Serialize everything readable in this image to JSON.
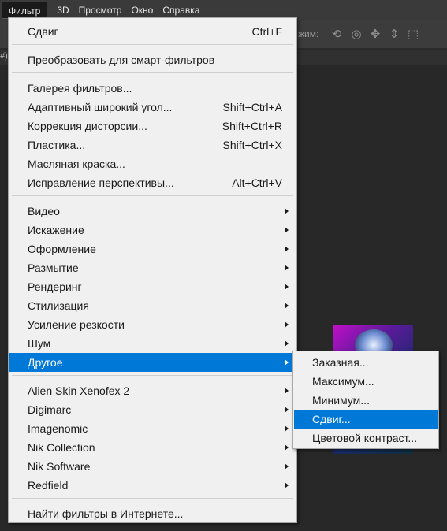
{
  "menubar": {
    "items": [
      {
        "label": "Фильтр"
      },
      {
        "label": "3D"
      },
      {
        "label": "Просмотр"
      },
      {
        "label": "Окно"
      },
      {
        "label": "Справка"
      }
    ]
  },
  "options_bar": {
    "mode_label_fragment": "жим:",
    "icons": [
      "rotate-3d-icon",
      "roll-3d-icon",
      "pan-3d-icon",
      "slide-3d-icon",
      "scale-3d-icon"
    ]
  },
  "tab_bar": {
    "fragment": "#)"
  },
  "filter_menu": {
    "items": [
      {
        "label": "Сдвиг",
        "shortcut": "Ctrl+F",
        "submenu": false
      },
      {
        "label": "Преобразовать для смарт-фильтров",
        "shortcut": "",
        "submenu": false
      },
      {
        "label": "Галерея фильтров...",
        "shortcut": "",
        "submenu": false
      },
      {
        "label": "Адаптивный широкий угол...",
        "shortcut": "Shift+Ctrl+A",
        "submenu": false
      },
      {
        "label": "Коррекция дисторсии...",
        "shortcut": "Shift+Ctrl+R",
        "submenu": false
      },
      {
        "label": "Пластика...",
        "shortcut": "Shift+Ctrl+X",
        "submenu": false
      },
      {
        "label": "Масляная краска...",
        "shortcut": "",
        "submenu": false
      },
      {
        "label": "Исправление перспективы...",
        "shortcut": "Alt+Ctrl+V",
        "submenu": false
      },
      {
        "label": "Видео",
        "submenu": true
      },
      {
        "label": "Искажение",
        "submenu": true
      },
      {
        "label": "Оформление",
        "submenu": true
      },
      {
        "label": "Размытие",
        "submenu": true
      },
      {
        "label": "Рендеринг",
        "submenu": true
      },
      {
        "label": "Стилизация",
        "submenu": true
      },
      {
        "label": "Усиление резкости",
        "submenu": true
      },
      {
        "label": "Шум",
        "submenu": true
      },
      {
        "label": "Другое",
        "submenu": true,
        "highlighted": true
      },
      {
        "label": "Alien Skin Xenofex 2",
        "submenu": true
      },
      {
        "label": "Digimarc",
        "submenu": true
      },
      {
        "label": "Imagenomic",
        "submenu": true
      },
      {
        "label": "Nik Collection",
        "submenu": true
      },
      {
        "label": "Nik Software",
        "submenu": true
      },
      {
        "label": "Redfield",
        "submenu": true
      },
      {
        "label": "Найти фильтры в Интернете...",
        "shortcut": "",
        "submenu": false
      }
    ]
  },
  "other_submenu": {
    "items": [
      {
        "label": "Заказная..."
      },
      {
        "label": "Максимум..."
      },
      {
        "label": "Минимум..."
      },
      {
        "label": "Сдвиг...",
        "highlighted": true
      },
      {
        "label": "Цветовой контраст..."
      }
    ]
  },
  "colors": {
    "highlight": "#0078d7",
    "menu_bg": "#f0f0f0",
    "app_bg": "#282828"
  }
}
